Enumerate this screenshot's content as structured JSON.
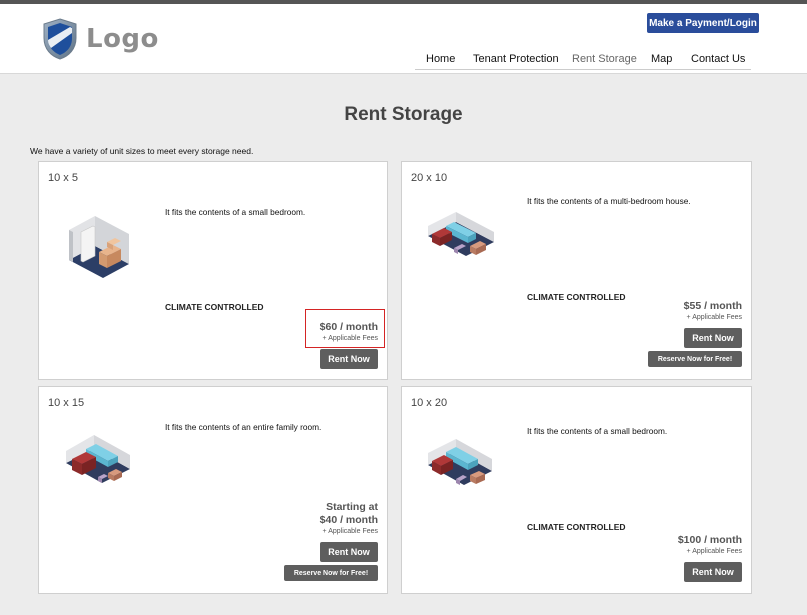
{
  "header": {
    "logo_text": "Logo",
    "pay_button_label": "Make a Payment/Login",
    "nav": [
      "Home",
      "Tenant Protection",
      "Rent Storage",
      "Map",
      "Contact Us"
    ]
  },
  "page": {
    "title": "Rent Storage",
    "intro": "We have a variety of unit sizes to meet every storage need."
  },
  "units": [
    {
      "size": "10 x 5",
      "description": "It fits the contents of a small bedroom.",
      "climate": "CLIMATE CONTROLLED",
      "price": "$60 / month",
      "fees": "+ Applicable Fees",
      "rent_label": "Rent Now"
    },
    {
      "size": "20 x 10",
      "description": "It fits the contents of a multi-bedroom house.",
      "climate": "CLIMATE CONTROLLED",
      "price": "$55 / month",
      "fees": "+ Applicable Fees",
      "rent_label": "Rent Now",
      "reserve_label": "Reserve Now for Free!"
    },
    {
      "size": "10 x 15",
      "description": "It fits the contents of an entire family room.",
      "price_prefix": "Starting at",
      "price": "$40 / month",
      "fees": "+ Applicable Fees",
      "rent_label": "Rent Now",
      "reserve_label": "Reserve Now for Free!"
    },
    {
      "size": "10 x 20",
      "description": "It fits the contents of a small bedroom.",
      "climate": "CLIMATE CONTROLLED",
      "price": "$100 / month",
      "fees": "+ Applicable Fees",
      "rent_label": "Rent Now"
    }
  ],
  "colors": {
    "accent": "#2a4d9b",
    "button": "#5e5e5e",
    "highlight": "#d42424",
    "background": "#ececec"
  },
  "icons": [
    "shield-logo-icon",
    "storage-unit-small-icon",
    "storage-unit-furnished-icon"
  ]
}
